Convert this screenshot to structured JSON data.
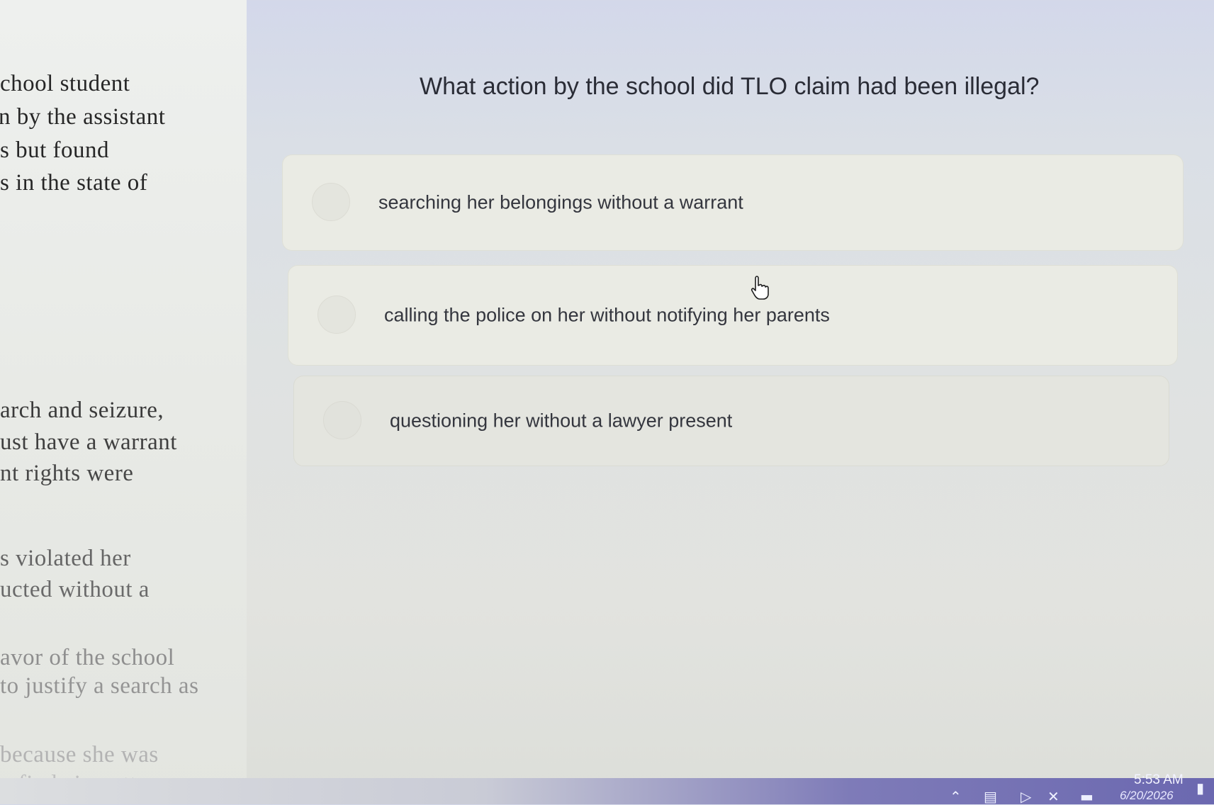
{
  "passage": {
    "lines": [
      "chool student",
      "n by the assistant",
      "s but found",
      "s in the state of",
      "arch and seizure,",
      "ust have a warrant",
      "nt rights were",
      "s violated her",
      "ucted without a",
      "avor of the school",
      " to justify a search as",
      "because she was",
      "o find cigarettes."
    ]
  },
  "question": {
    "text": "What action by the school did TLO claim had been illegal?"
  },
  "answers": [
    {
      "label": "searching her belongings without a warrant"
    },
    {
      "label": "calling the police on her without notifying her parents"
    },
    {
      "label": "questioning her without a lawyer present"
    }
  ],
  "taskbar": {
    "time": "5:53 AM",
    "date": "6/20/2026",
    "icons": [
      "chevron-up-icon",
      "network-icon",
      "speaker-icon",
      "mute-icon",
      "battery-icon",
      "notification-icon"
    ]
  }
}
